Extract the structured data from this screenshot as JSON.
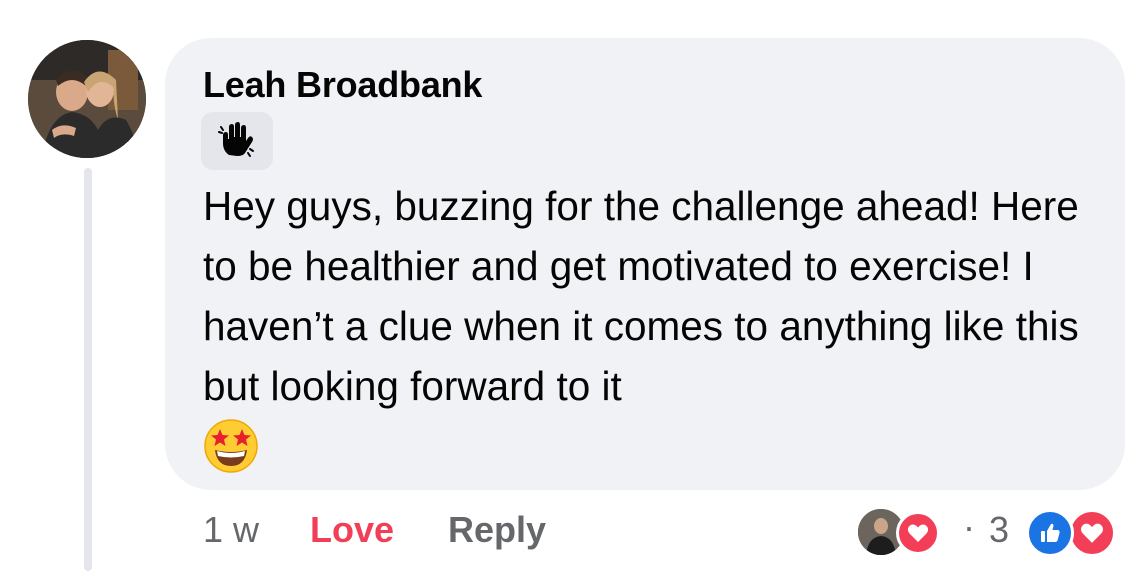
{
  "comment": {
    "author": "Leah Broadbank",
    "badge_icon": "wave-icon",
    "text": "Hey guys, buzzing for the challenge ahead! Here to be healthier and get motivated to exercise! I haven’t a clue when it comes to anything like this but looking forward to it",
    "emoji": "star-struck-emoji",
    "timestamp": "1 w",
    "love_label": "Love",
    "reply_label": "Reply",
    "reply_reaction_separator": "·",
    "reaction_count": "3",
    "reaction_types": [
      "like",
      "love"
    ]
  },
  "colors": {
    "bubble": "#f0f2f5",
    "love_red": "#f33e58",
    "like_blue": "#1b74e4",
    "meta_gray": "#65676b"
  }
}
